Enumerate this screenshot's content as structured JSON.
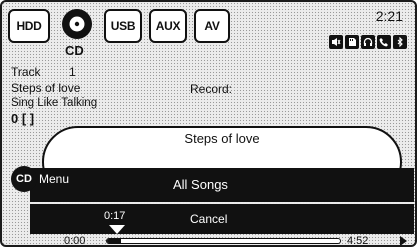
{
  "sources": {
    "hdd": "HDD",
    "cd": "CD",
    "usb": "USB",
    "aux": "AUX",
    "av": "AV"
  },
  "clock": "2:21",
  "status_icons": [
    "mute-icon",
    "sd-card-icon",
    "headphones-icon",
    "phone-icon",
    "bluetooth-icon"
  ],
  "now_playing": {
    "track_label": "Track",
    "track_number": "1",
    "title": "Steps of love",
    "artist": "Sing Like Talking",
    "counter": "0 [  ]",
    "record_label": "Record:"
  },
  "menu": {
    "title": "Steps of love",
    "cd_badge": "CD",
    "menu_label": "Menu",
    "item_all_songs": "All Songs",
    "item_cancel": "Cancel"
  },
  "progress": {
    "elapsed": "0:00",
    "marker_time": "0:17",
    "duration": "4:52",
    "fraction": 0.06
  },
  "colors": {
    "ink": "#111111",
    "paper": "#ffffff"
  }
}
